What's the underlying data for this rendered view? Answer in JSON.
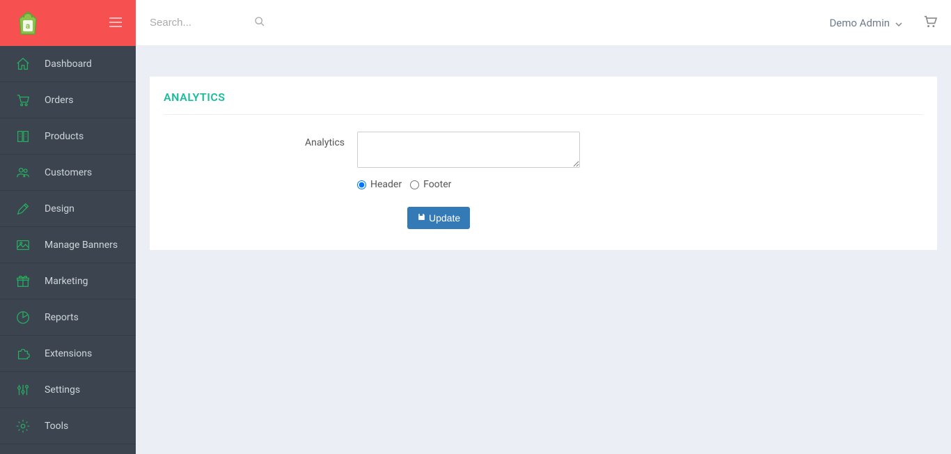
{
  "header": {
    "search_placeholder": "Search...",
    "user_name": "Demo Admin"
  },
  "sidebar": {
    "items": [
      {
        "label": "Dashboard",
        "icon": "home"
      },
      {
        "label": "Orders",
        "icon": "cart"
      },
      {
        "label": "Products",
        "icon": "book"
      },
      {
        "label": "Customers",
        "icon": "users"
      },
      {
        "label": "Design",
        "icon": "pencil"
      },
      {
        "label": "Manage Banners",
        "icon": "image"
      },
      {
        "label": "Marketing",
        "icon": "gift"
      },
      {
        "label": "Reports",
        "icon": "pie"
      },
      {
        "label": "Extensions",
        "icon": "puzzle"
      },
      {
        "label": "Settings",
        "icon": "sliders"
      },
      {
        "label": "Tools",
        "icon": "gear"
      }
    ]
  },
  "main": {
    "panel_title": "ANALYTICS",
    "form": {
      "label": "Analytics",
      "value": "",
      "radio_header": "Header",
      "radio_footer": "Footer",
      "button_label": "Update"
    }
  }
}
